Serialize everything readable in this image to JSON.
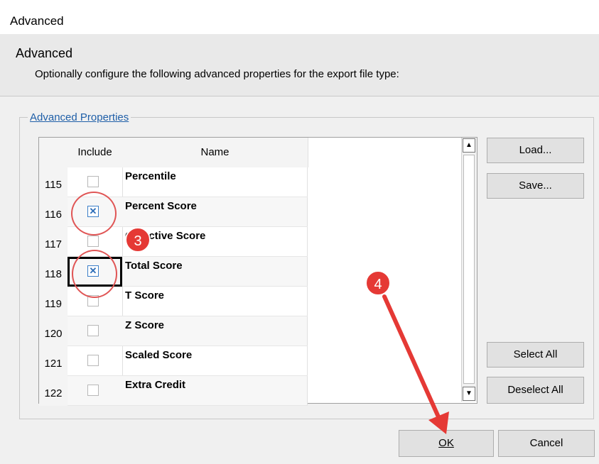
{
  "window": {
    "title": "Advanced"
  },
  "header": {
    "title": "Advanced",
    "subtitle": "Optionally configure the following advanced properties for the export file type:"
  },
  "group": {
    "legend": "Advanced Properties"
  },
  "table": {
    "columns": {
      "include": "Include",
      "name": "Name"
    },
    "rows": [
      {
        "num": "115",
        "name": "Percentile",
        "checked": false
      },
      {
        "num": "116",
        "name": "Percent Score",
        "checked": true
      },
      {
        "num": "117",
        "name": "Objective Score",
        "checked": false
      },
      {
        "num": "118",
        "name": "Total Score",
        "checked": true
      },
      {
        "num": "119",
        "name": "T Score",
        "checked": false
      },
      {
        "num": "120",
        "name": "Z Score",
        "checked": false
      },
      {
        "num": "121",
        "name": "Scaled Score",
        "checked": false
      },
      {
        "num": "122",
        "name": "Extra Credit",
        "checked": false
      }
    ]
  },
  "buttons": {
    "load": "Load...",
    "save": "Save...",
    "select_all": "Select All",
    "deselect_all": "Deselect All",
    "ok": "OK",
    "cancel": "Cancel"
  },
  "annotations": {
    "step3": "3",
    "step4": "4",
    "color": "#e53935"
  },
  "icons": {
    "check": "checkmark-x-icon",
    "scroll_up": "triangle-up-icon",
    "scroll_down": "triangle-down-icon"
  }
}
